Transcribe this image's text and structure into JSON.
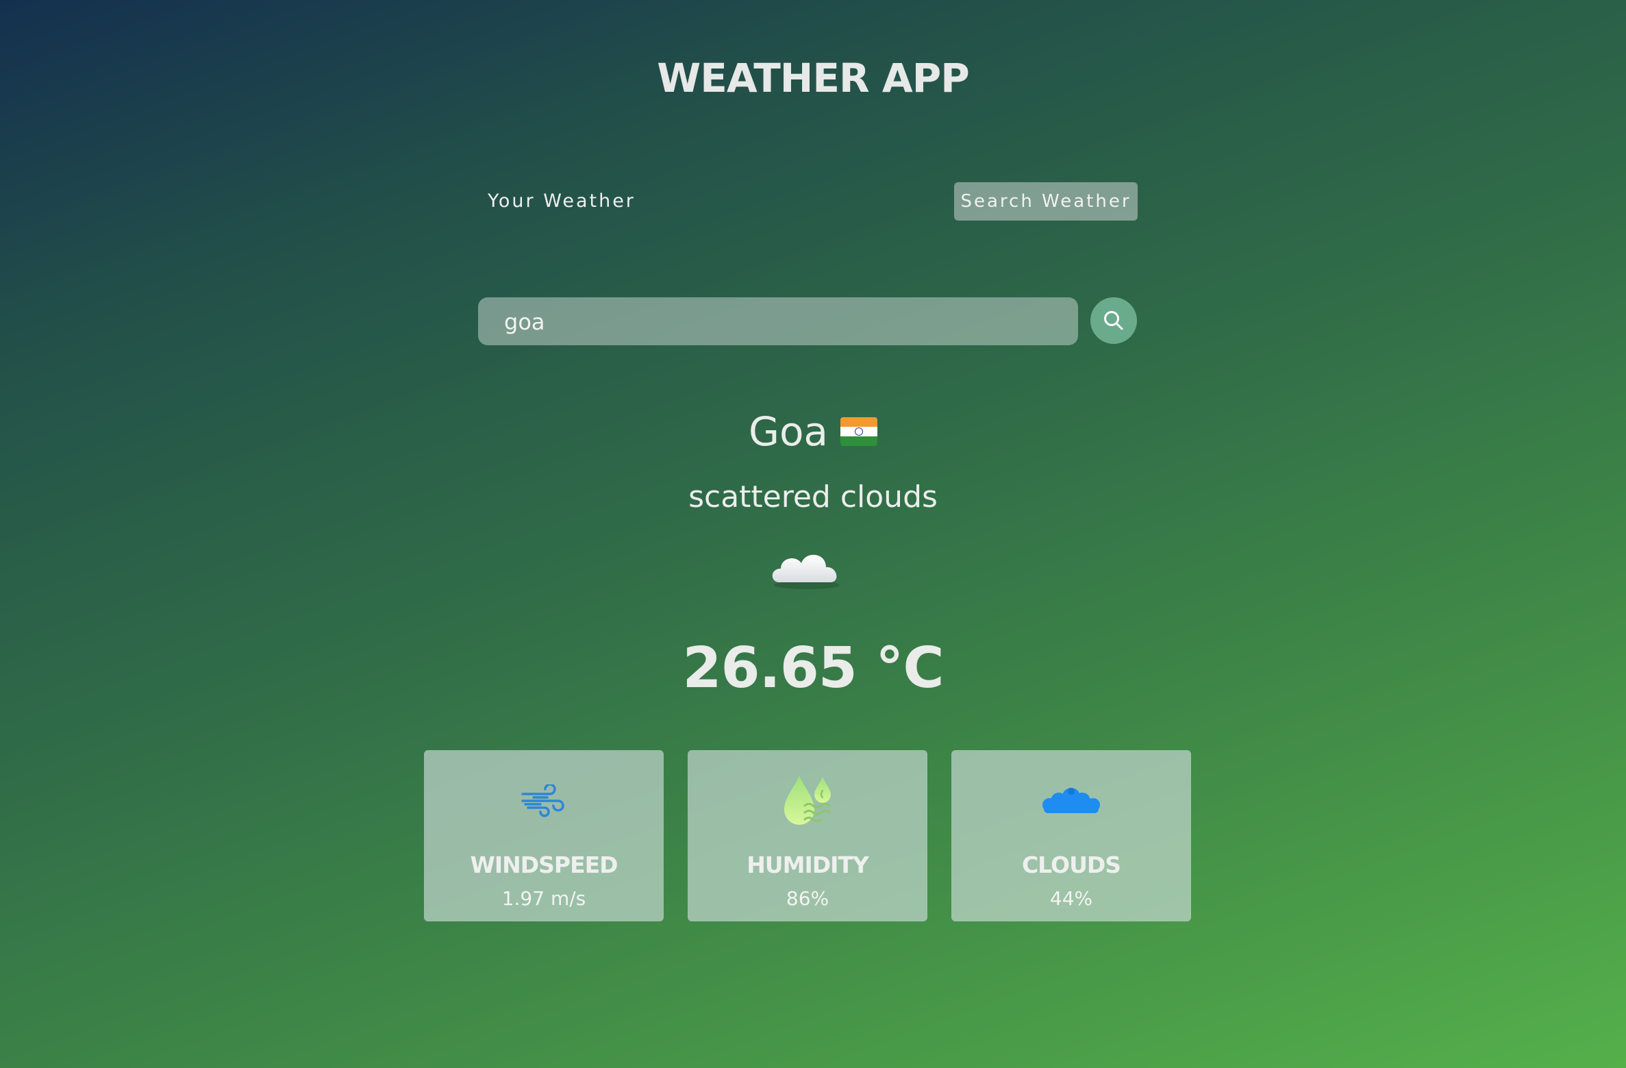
{
  "header": {
    "title": "WEATHER APP"
  },
  "tabs": {
    "your_weather": "Your Weather",
    "search_weather": "Search Weather"
  },
  "search": {
    "value": "goa",
    "icon": "search-icon"
  },
  "weather": {
    "city": "Goa",
    "flag": "india-flag",
    "description": "scattered clouds",
    "condition_icon": "cloud-icon",
    "temperature": "26.65 °C"
  },
  "cards": [
    {
      "label": "WINDSPEED",
      "value": "1.97 m/s",
      "icon": "wind-icon"
    },
    {
      "label": "HUMIDITY",
      "value": "86%",
      "icon": "humidity-icon"
    },
    {
      "label": "CLOUDS",
      "value": "44%",
      "icon": "clouds-icon"
    }
  ],
  "colors": {
    "accent": "#6aab8c",
    "wind_icon": "#2e86d6",
    "humidity_icon": "#b8ef7a",
    "clouds_icon": "#1e8cf0"
  }
}
